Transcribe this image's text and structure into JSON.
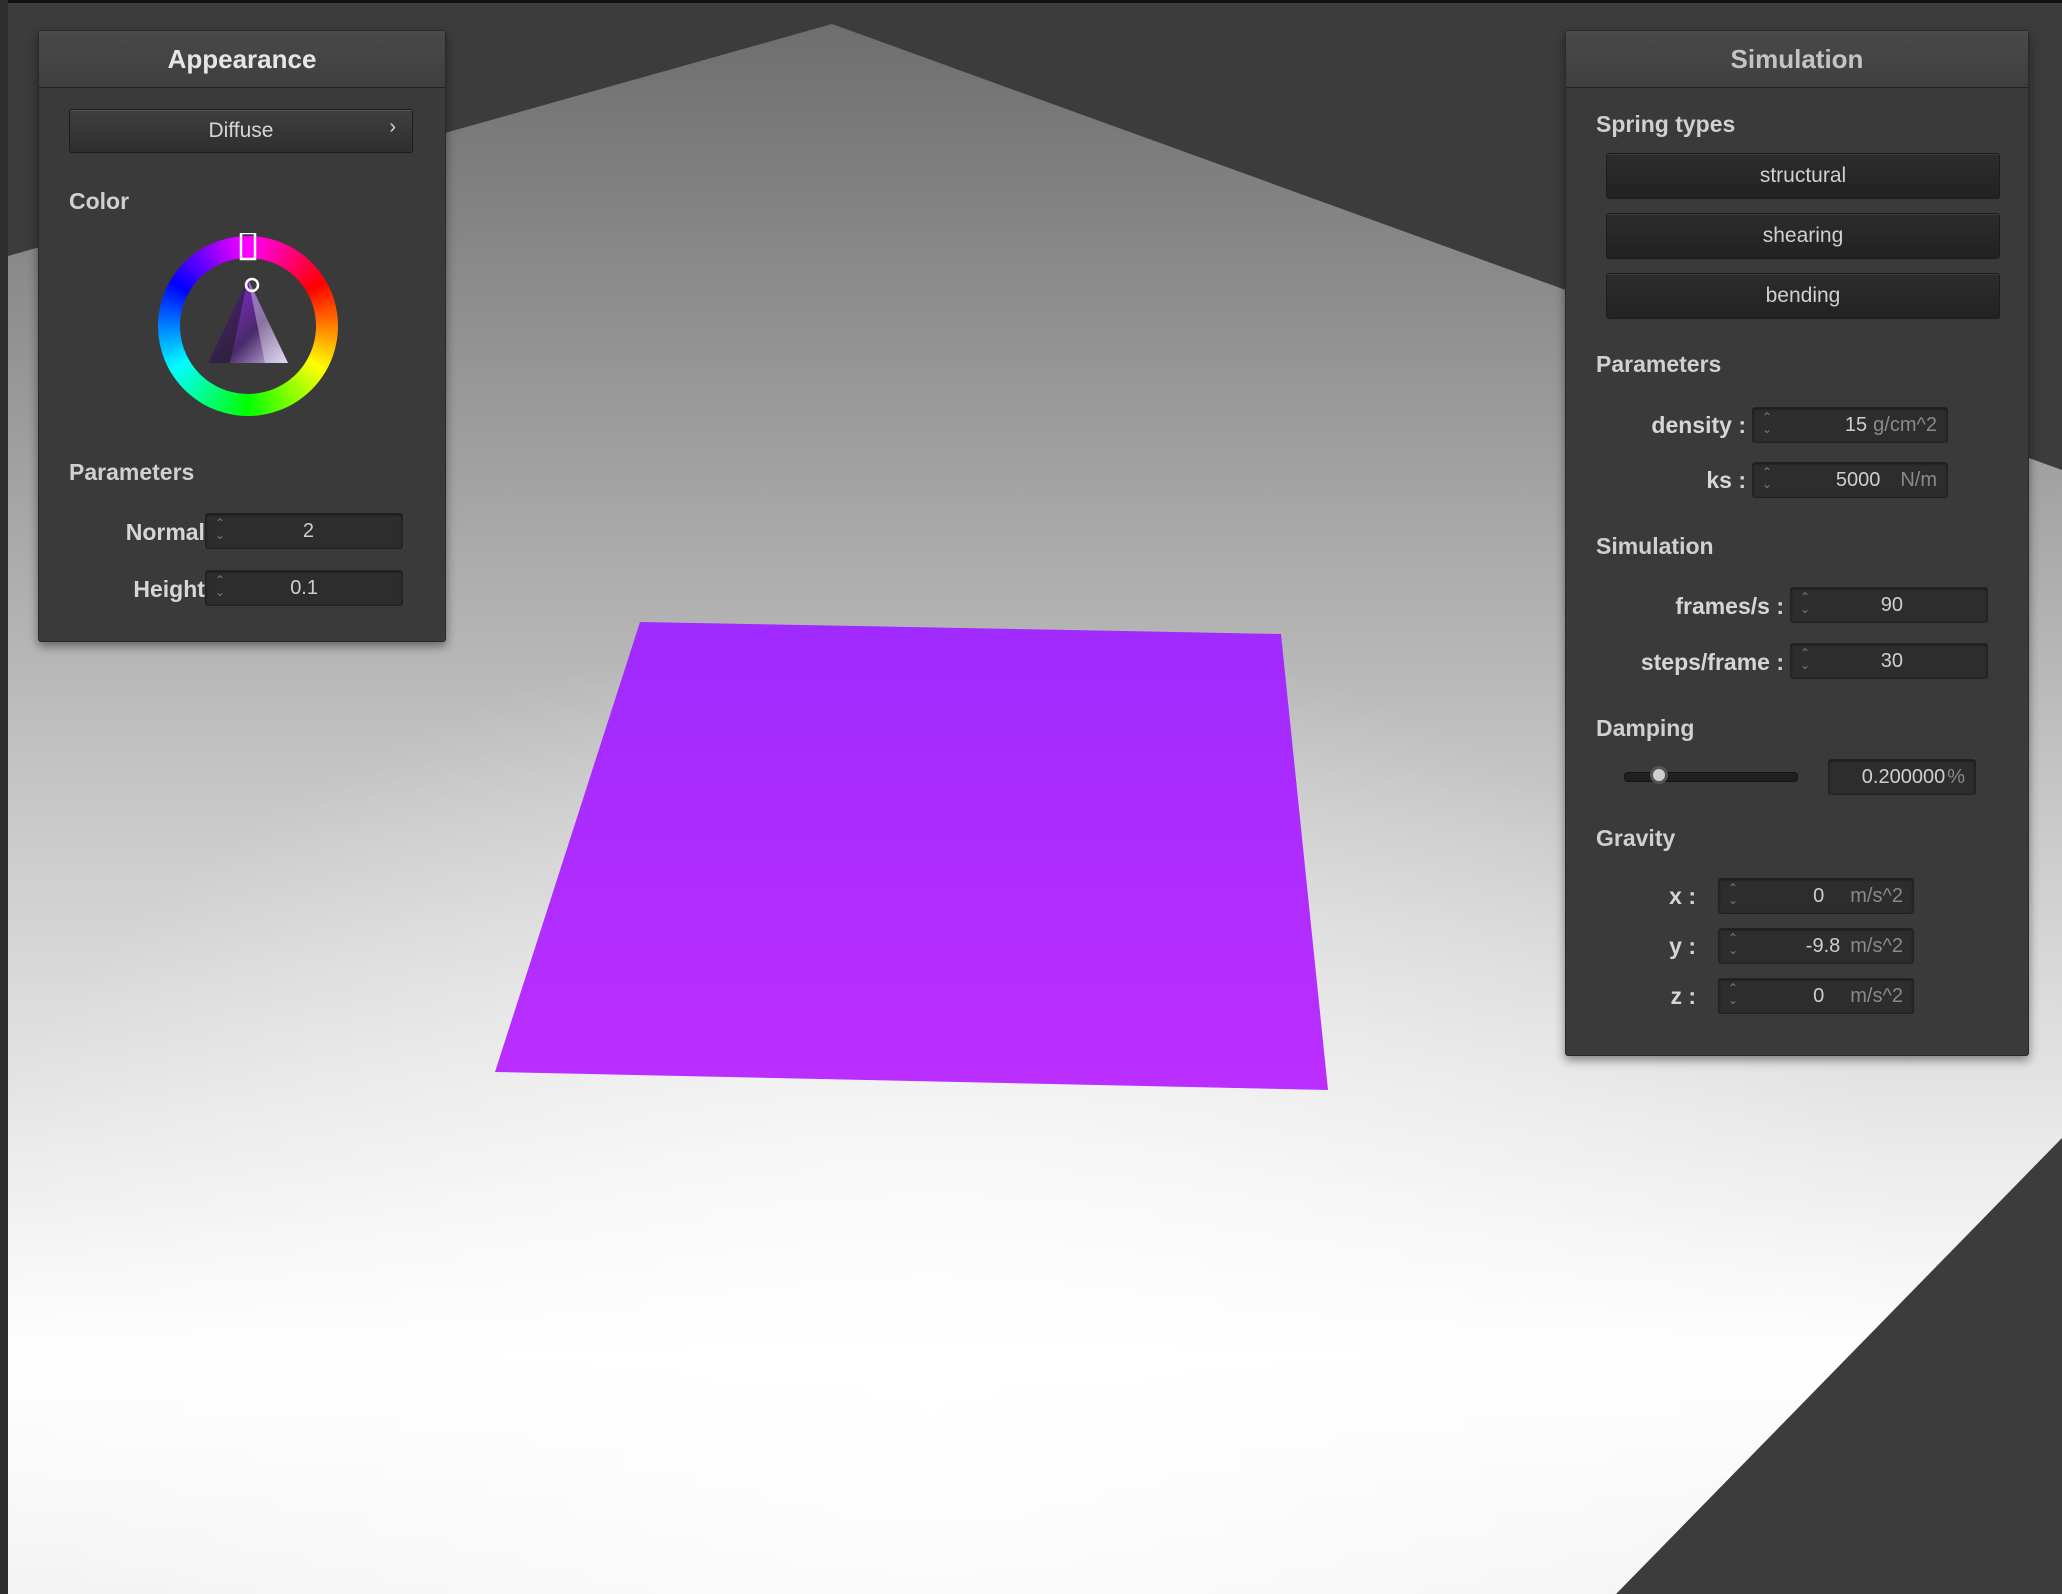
{
  "appearance": {
    "title": "Appearance",
    "shader_select": "Diffuse",
    "color_label": "Color",
    "parameters_label": "Parameters",
    "normal_label": "Normal :",
    "normal_value": "2",
    "height_label": "Height :",
    "height_value": "0.1",
    "selected_color": "#9a2bff"
  },
  "simulation": {
    "title": "Simulation",
    "spring_types_label": "Spring types",
    "spring_buttons": [
      "structural",
      "shearing",
      "bending"
    ],
    "parameters_label": "Parameters",
    "density_label": "density :",
    "density_value": "15",
    "density_unit": "g/cm^2",
    "ks_label": "ks :",
    "ks_value": "5000",
    "ks_unit": "N/m",
    "simulation_label": "Simulation",
    "fps_label": "frames/s :",
    "fps_value": "90",
    "steps_label": "steps/frame :",
    "steps_value": "30",
    "damping_label": "Damping",
    "damping_value": "0.200000",
    "damping_unit": "%",
    "damping_level": 0.1,
    "gravity_label": "Gravity",
    "gx_label": "x :",
    "gx_value": "0",
    "gy_label": "y :",
    "gy_value": "-9.8",
    "gz_label": "z :",
    "gz_value": "0",
    "gravity_unit": "m/s^2"
  },
  "scene": {
    "cloth_color": "#b02cff"
  }
}
